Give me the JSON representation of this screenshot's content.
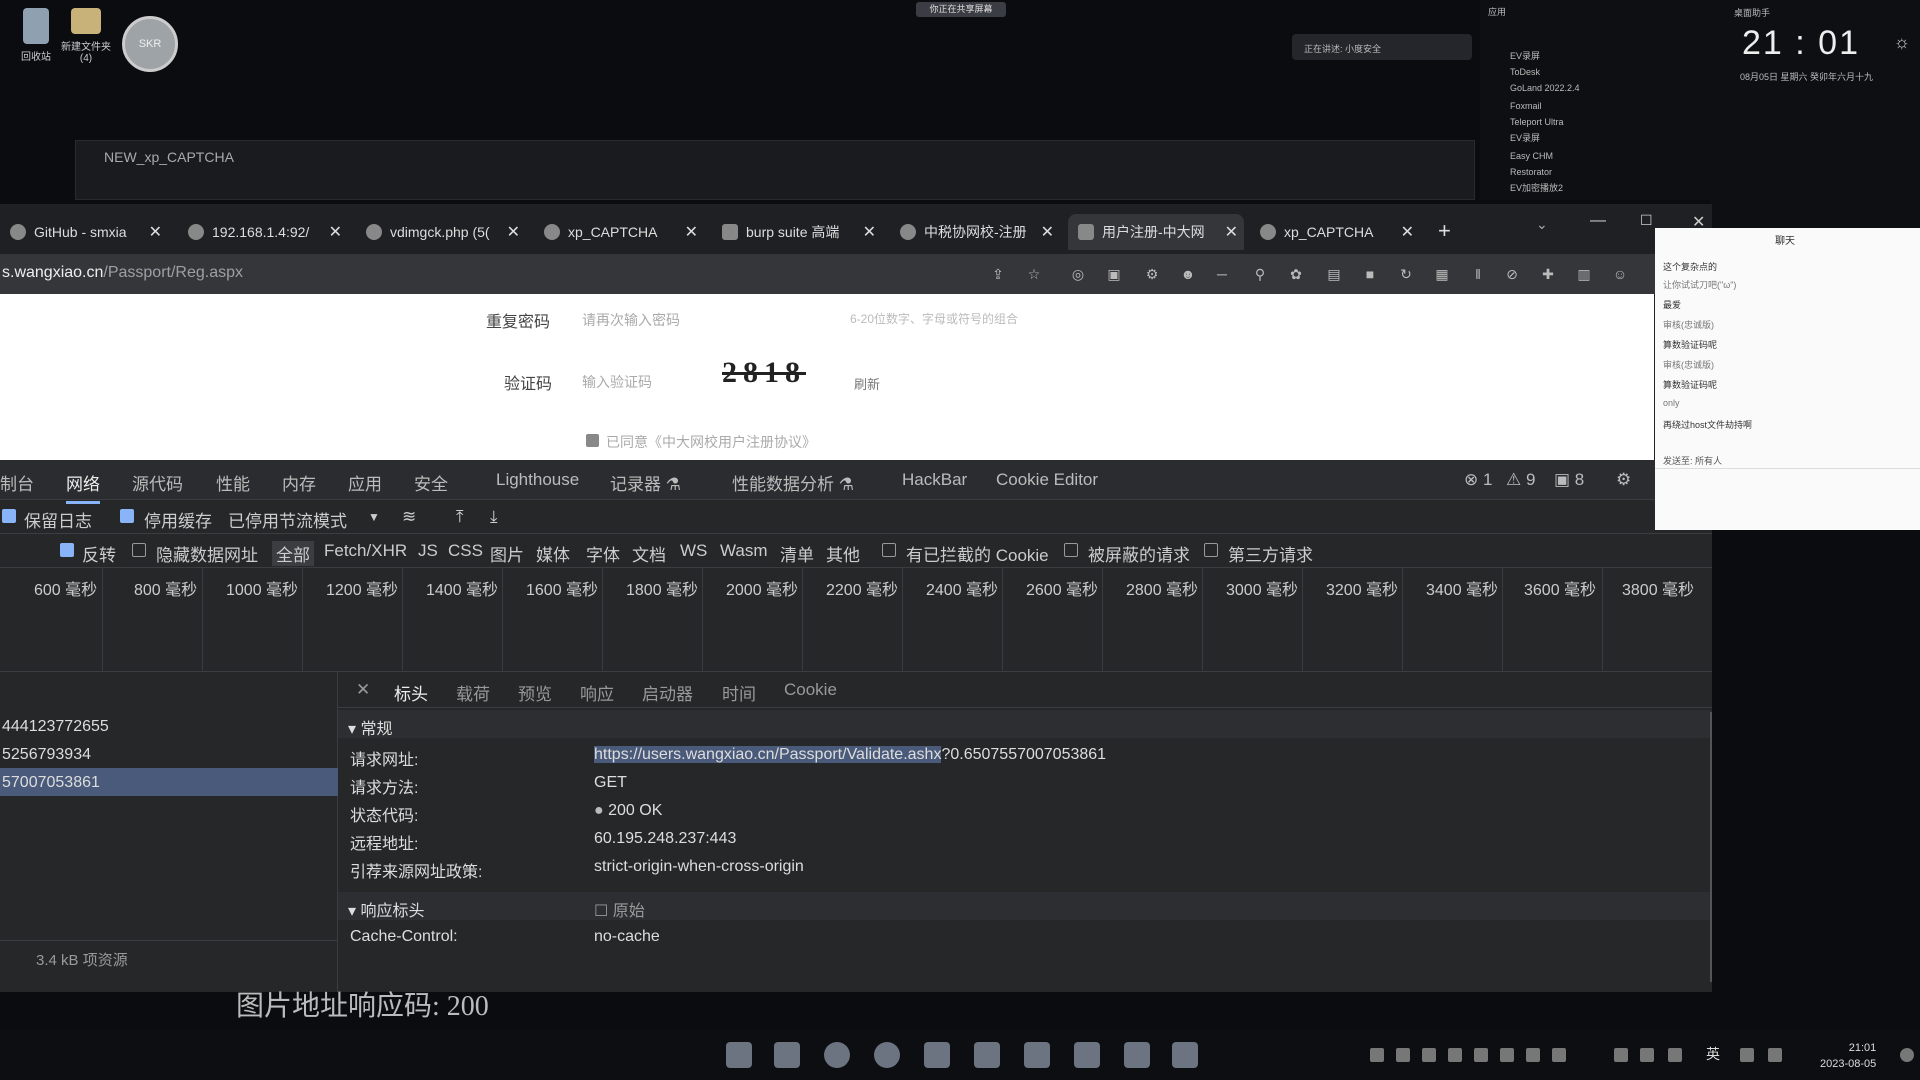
{
  "desktop": {
    "icons": [
      {
        "label": "回收站"
      },
      {
        "label": "新建文件夹\n(4)"
      }
    ],
    "avatar_text": "SKR",
    "top_pill": "你正在共享屏幕",
    "bg_window_title": "NEW_xp_CAPTCHA",
    "notification": "正在讲述: 小度安全"
  },
  "right_panel": {
    "title": "应用",
    "items": [
      "EV录屏",
      "ToDesk",
      "GoLand 2022.2.4",
      "Foxmail",
      "Teleport Ultra",
      "EV录屏",
      "Easy CHM",
      "Restorator",
      "EV加密播放2"
    ]
  },
  "clock": {
    "header": "桌面助手",
    "time": "21 : 01",
    "date": "08月05日  星期六  癸卯年六月十九"
  },
  "browser": {
    "tabs": [
      {
        "label": "GitHub - smxia"
      },
      {
        "label": "192.168.1.4:92/"
      },
      {
        "label": "vdimgck.php (5("
      },
      {
        "label": "xp_CAPTCHA"
      },
      {
        "label": "burp suite 高端"
      },
      {
        "label": "中税协网校-注册"
      },
      {
        "label": "用户注册-中大网"
      },
      {
        "label": "xp_CAPTCHA"
      }
    ],
    "url_host": "s.wangxiao.cn",
    "url_path": "/Passport/Reg.aspx"
  },
  "page": {
    "repeat_pwd_label": "重复密码",
    "repeat_pwd_placeholder": "请再次输入密码",
    "pwd_hint": "6-20位数字、字母或符号的组合",
    "captcha_label": "验证码",
    "captcha_placeholder": "输入验证码",
    "captcha_text": "2818",
    "refresh": "刷新",
    "agree": "已同意《中大网校用户注册协议》"
  },
  "devtools": {
    "tabs": [
      "制台",
      "网络",
      "源代码",
      "性能",
      "内存",
      "应用",
      "安全",
      "Lighthouse",
      "记录器 ⚗",
      "性能数据分析 ⚗",
      "HackBar",
      "Cookie Editor"
    ],
    "counts": {
      "errors": "1",
      "warnings": "9",
      "messages": "8"
    },
    "bar1": {
      "preserve_log": "保留日志",
      "disable_cache": "停用缓存",
      "throttle": "已停用节流模式"
    },
    "bar2": {
      "invert": "反转",
      "hide_data_urls": "隐藏数据网址",
      "filters": [
        "全部",
        "Fetch/XHR",
        "JS",
        "CSS",
        "图片",
        "媒体",
        "字体",
        "文档",
        "WS",
        "Wasm",
        "清单",
        "其他"
      ],
      "blocked_cookies": "有已拦截的 Cookie",
      "blocked_requests": "被屏蔽的请求",
      "third_party": "第三方请求"
    },
    "ticks": [
      "600 毫秒",
      "800 毫秒",
      "1000 毫秒",
      "1200 毫秒",
      "1400 毫秒",
      "1600 毫秒",
      "1800 毫秒",
      "2000 毫秒",
      "2200 毫秒",
      "2400 毫秒",
      "2600 毫秒",
      "2800 毫秒",
      "3000 毫秒",
      "3200 毫秒",
      "3400 毫秒",
      "3600 毫秒",
      "3800 毫秒"
    ],
    "requests": [
      "444123772655",
      "5256793934",
      "57007053861"
    ],
    "footer": "3.4 kB 项资源",
    "detail_tabs": [
      "标头",
      "载荷",
      "预览",
      "响应",
      "启动器",
      "时间",
      "Cookie"
    ],
    "general_title": "常规",
    "general": [
      {
        "k": "请求网址:",
        "v_hl": "https://users.wangxiao.cn/Passport/Validate.ashx",
        "v": "?0.6507557007053861"
      },
      {
        "k": "请求方法:",
        "v": "GET"
      },
      {
        "k": "状态代码:",
        "v": "200 OK"
      },
      {
        "k": "远程地址:",
        "v": "60.195.248.237:443"
      },
      {
        "k": "引荐来源网址政策:",
        "v": "strict-origin-when-cross-origin"
      }
    ],
    "resp_title": "响应标头",
    "raw": "原始",
    "resp": [
      {
        "k": "Cache-Control:",
        "v": "no-cache"
      }
    ]
  },
  "bottom_text": "图片地址响应码:   200",
  "chat": {
    "title": "聊天",
    "messages": [
      "这个复杂点的",
      "让你试试刀吧(\"ω\")",
      "最爱",
      "审核(忠诚版)",
      "算数验证码呢",
      "审核(忠诚版)",
      "算数验证码呢",
      "only",
      "再绕过host文件劫持啊"
    ],
    "send_to": "发送至:  所有人"
  },
  "taskbar": {
    "ime": "英",
    "time": "21:01",
    "date": "2023-08-05"
  }
}
